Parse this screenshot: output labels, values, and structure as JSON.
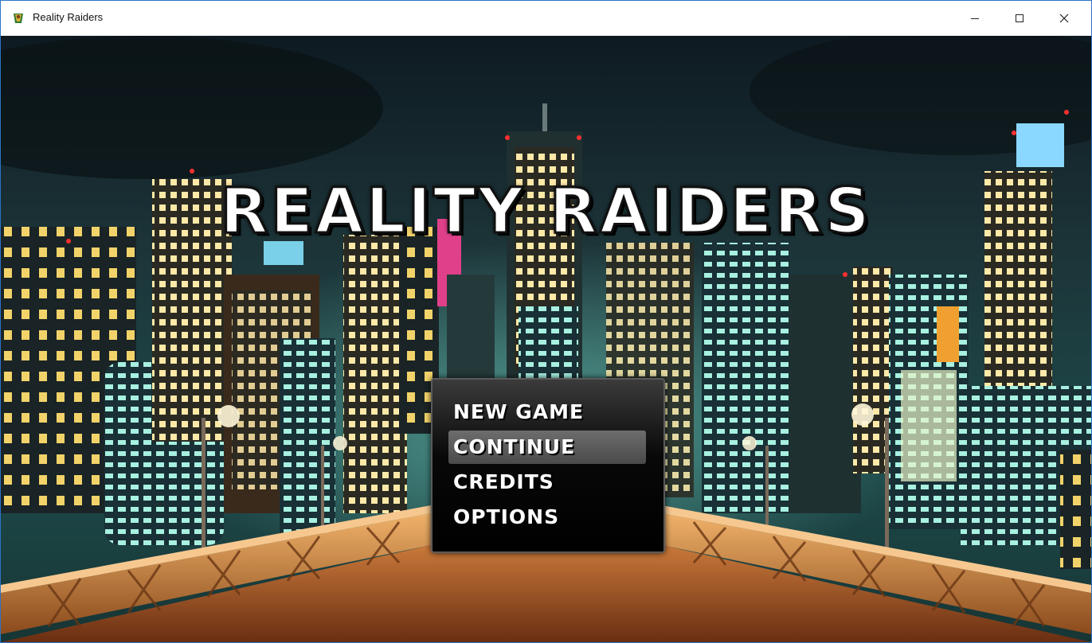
{
  "window": {
    "title": "Reality Raiders",
    "app_icon": "game-icon",
    "controls": {
      "minimize": "—",
      "maximize": "☐",
      "close": "✕"
    }
  },
  "game": {
    "title": "REALITY RAIDERS",
    "menu": {
      "items": [
        {
          "label": "NEW GAME",
          "selected": false
        },
        {
          "label": "CONTINUE",
          "selected": true
        },
        {
          "label": "CREDITS",
          "selected": false
        },
        {
          "label": "OPTIONS",
          "selected": false
        }
      ]
    }
  },
  "colors": {
    "window_border": "#2b73c8",
    "menu_highlight": "#5a5a5a",
    "title_text": "#ffffff"
  }
}
